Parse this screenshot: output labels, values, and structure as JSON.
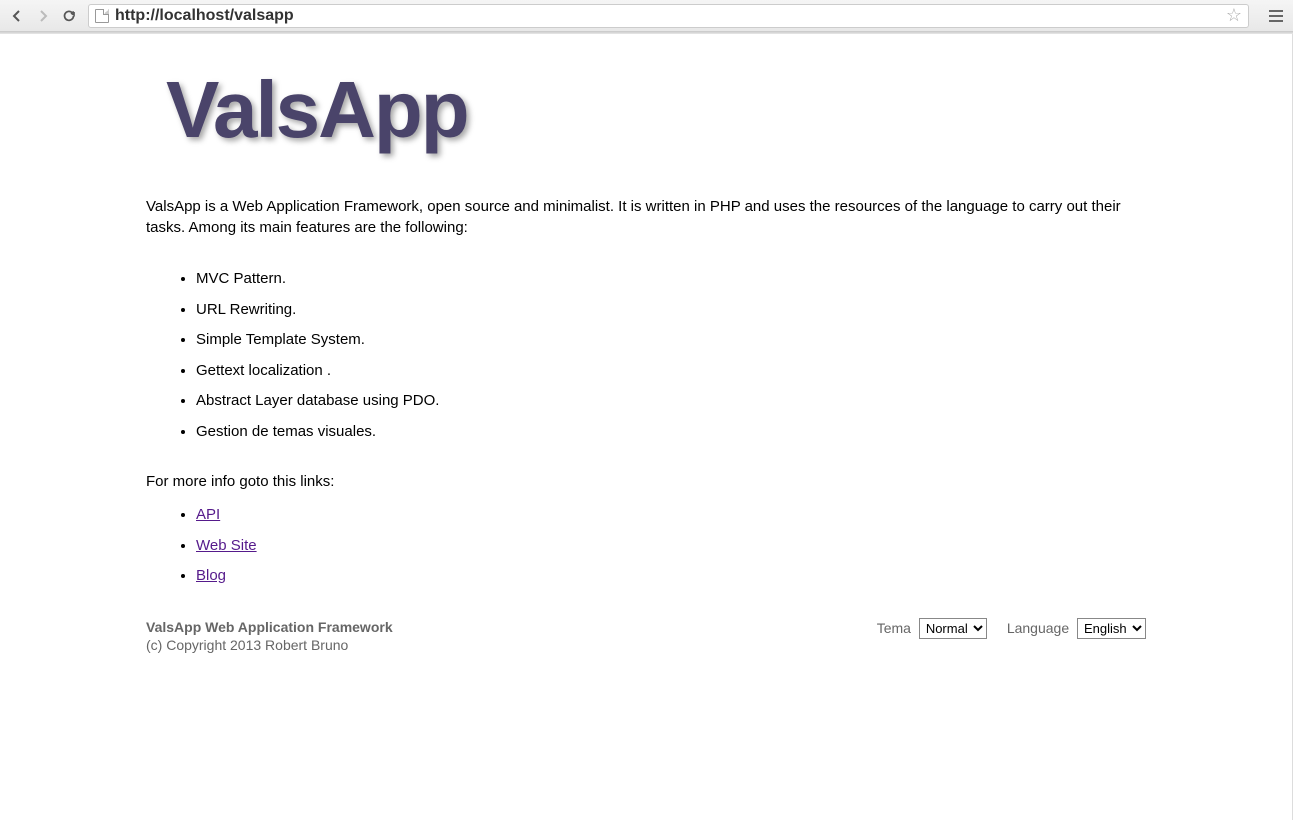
{
  "browser": {
    "url": "http://localhost/valsapp"
  },
  "logo": "ValsApp",
  "intro": "ValsApp is a Web Application Framework, open source and minimalist. It is written in PHP and uses the resources of the language to carry out their tasks. Among its main features are the following:",
  "features": [
    "MVC Pattern.",
    "URL Rewriting.",
    "Simple Template System.",
    "Gettext localization .",
    "Abstract Layer database using PDO.",
    "Gestion de temas visuales."
  ],
  "more_info": "For more info goto this links:",
  "links": [
    "API",
    "Web Site",
    "Blog"
  ],
  "footer": {
    "title": "ValsApp Web Application Framework",
    "copyright": "(c) Copyright 2013 Robert Bruno",
    "tema_label": "Tema",
    "tema_value": "Normal",
    "language_label": "Language",
    "language_value": "English"
  }
}
